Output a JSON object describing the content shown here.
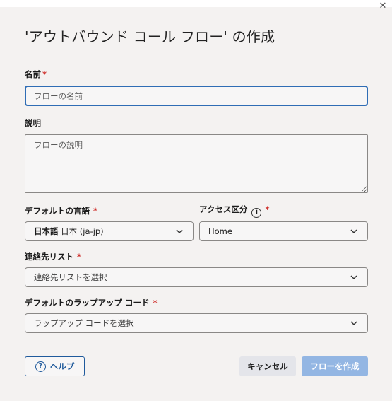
{
  "dialog": {
    "title": "'アウトバウンド コール フロー' の作成",
    "close_icon": "close-icon"
  },
  "fields": {
    "name": {
      "label": "名前",
      "required": "*",
      "placeholder": "フローの名前",
      "value": ""
    },
    "description": {
      "label": "説明",
      "placeholder": "フローの説明",
      "value": ""
    },
    "default_language": {
      "label": "デフォルトの言語",
      "required": "*",
      "value_bold": "日本語",
      "value_rest": " 日本 (ja-jp)"
    },
    "access_division": {
      "label": "アクセス区分",
      "required": "*",
      "info_icon": "info-icon",
      "value": "Home"
    },
    "contact_list": {
      "label": "連絡先リスト",
      "required": "*",
      "placeholder": "連絡先リストを選択"
    },
    "default_wrapup": {
      "label": "デフォルトのラップアップ コード",
      "required": "*",
      "placeholder": "ラップアップ コードを選択"
    }
  },
  "buttons": {
    "help": "ヘルプ",
    "cancel": "キャンセル",
    "create": "フローを作成"
  },
  "colors": {
    "background": "#f4f2f1",
    "focus_border": "#2f6db5",
    "required": "#d0312d",
    "primary_disabled": "#93b6e3",
    "link_blue": "#1f5a9c"
  }
}
